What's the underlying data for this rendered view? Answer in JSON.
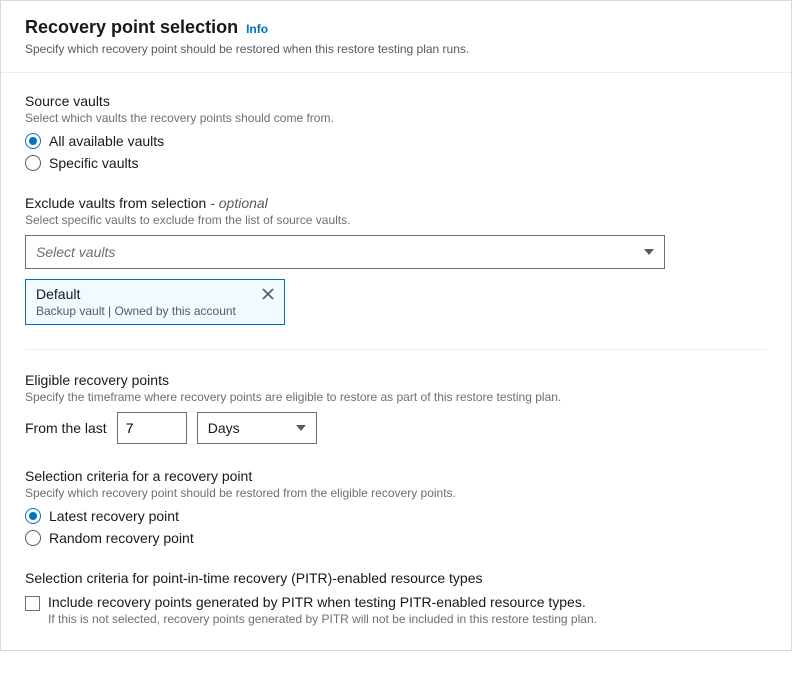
{
  "header": {
    "title": "Recovery point selection",
    "info": "Info",
    "subtitle": "Specify which recovery point should be restored when this restore testing plan runs."
  },
  "sourceVaults": {
    "label": "Source vaults",
    "help": "Select which vaults the recovery points should come from.",
    "options": {
      "all": "All available vaults",
      "specific": "Specific vaults"
    }
  },
  "excludeVaults": {
    "label_main": "Exclude vaults from selection",
    "label_optional": " - optional",
    "help": "Select specific vaults to exclude from the list of source vaults.",
    "placeholder": "Select vaults",
    "chip": {
      "title": "Default",
      "sub": "Backup vault | Owned by this account"
    }
  },
  "eligible": {
    "label": "Eligible recovery points",
    "help": "Specify the timeframe where recovery points are eligible to restore as part of this restore testing plan.",
    "from_label": "From the last",
    "value": "7",
    "unit": "Days"
  },
  "selection": {
    "label": "Selection criteria for a recovery point",
    "help": "Specify which recovery point should be restored from the eligible recovery points.",
    "options": {
      "latest": "Latest recovery point",
      "random": "Random recovery point"
    }
  },
  "pitr": {
    "label": "Selection criteria for point-in-time recovery (PITR)-enabled resource types",
    "checkbox_label": "Include recovery points generated by PITR when testing PITR-enabled resource types.",
    "checkbox_help": "If this is not selected, recovery points generated by PITR will not be included in this restore testing plan."
  }
}
